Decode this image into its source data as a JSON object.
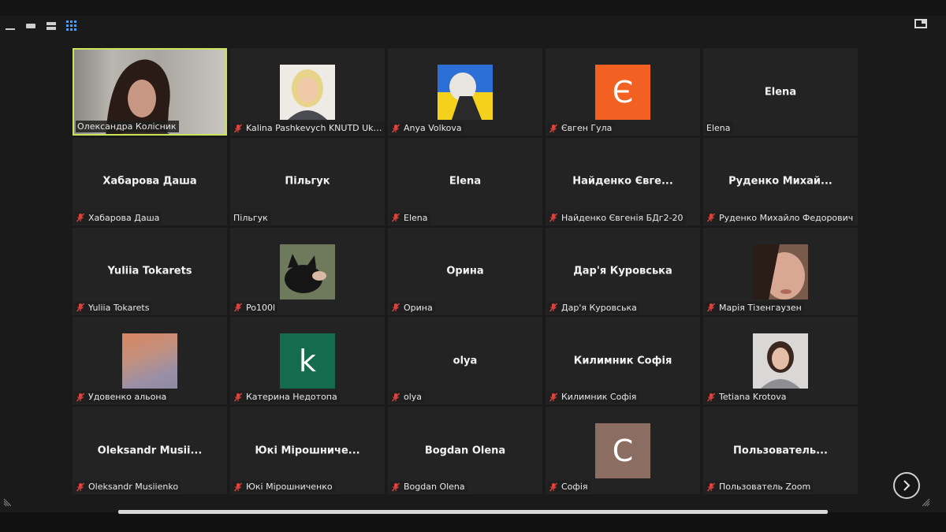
{
  "participants": [
    {
      "name": "Олександра Колісник",
      "center_name": "",
      "avatar": "video",
      "muted": false,
      "active": true
    },
    {
      "name": "Kalina Pashkevych KNUTD Ukraine",
      "center_name": "",
      "avatar": "photo-blonde",
      "muted": true
    },
    {
      "name": "Anya Volkova",
      "center_name": "",
      "avatar": "photo-anime-flag",
      "muted": true
    },
    {
      "name": "Євген Гула",
      "center_name": "",
      "avatar": "letter",
      "letter": "Є",
      "letter_color": "#f26122",
      "muted": true
    },
    {
      "name": "Elena",
      "center_name": "Elena",
      "avatar": "none",
      "muted": false
    },
    {
      "name": "Хабарова Даша",
      "center_name": "Хабарова Даша",
      "avatar": "none",
      "muted": true
    },
    {
      "name": "Пільгук",
      "center_name": "Пільгук",
      "avatar": "none",
      "muted": false
    },
    {
      "name": "Elena",
      "center_name": "Elena",
      "avatar": "none",
      "muted": true
    },
    {
      "name": "Найденко Євгенія БДг2-20",
      "center_name": "Найденко Євге...",
      "avatar": "none",
      "muted": true
    },
    {
      "name": "Руденко Михайло Федорович",
      "center_name": "Руденко  Михай...",
      "avatar": "none",
      "muted": true
    },
    {
      "name": "Yuliia Tokarets",
      "center_name": "Yuliia Tokarets",
      "avatar": "none",
      "muted": true
    },
    {
      "name": "Po100l",
      "center_name": "",
      "avatar": "photo-cat",
      "muted": true
    },
    {
      "name": "Орина",
      "center_name": "Орина",
      "avatar": "none",
      "muted": true
    },
    {
      "name": "Дар'я Куровська",
      "center_name": "Дар'я Куровська",
      "avatar": "none",
      "muted": true
    },
    {
      "name": "Марія Тізенгаузен",
      "center_name": "",
      "avatar": "photo-face",
      "muted": true
    },
    {
      "name": "Удовенко альона",
      "center_name": "",
      "avatar": "photo-abstract",
      "muted": true
    },
    {
      "name": "Катерина Недотопа",
      "center_name": "",
      "avatar": "letter",
      "letter": "k",
      "letter_color": "#156b4d",
      "muted": true
    },
    {
      "name": "olya",
      "center_name": "olya",
      "avatar": "none",
      "muted": true
    },
    {
      "name": "Килимник Софія",
      "center_name": "Килимник Софія",
      "avatar": "none",
      "muted": true
    },
    {
      "name": "Tetiana Krotova",
      "center_name": "",
      "avatar": "photo-woman",
      "muted": true
    },
    {
      "name": "Oleksandr Musiienko",
      "center_name": "Oleksandr  Musii...",
      "avatar": "none",
      "muted": true
    },
    {
      "name": "Юкі Мірошниченко",
      "center_name": "Юкі Мірошниче...",
      "avatar": "none",
      "muted": true
    },
    {
      "name": "Bogdan Olena",
      "center_name": "Bogdan Olena",
      "avatar": "none",
      "muted": true
    },
    {
      "name": "Софія",
      "center_name": "",
      "avatar": "letter",
      "letter": "С",
      "letter_color": "#8c6d62",
      "muted": true
    },
    {
      "name": "Пользователь Zoom",
      "center_name": "Пользователь...",
      "avatar": "none",
      "muted": true
    }
  ],
  "colors": {
    "active_speaker_border": "#c8e45a",
    "mute_icon": "#e0413a",
    "grid_icon": "#4a9ef5"
  }
}
